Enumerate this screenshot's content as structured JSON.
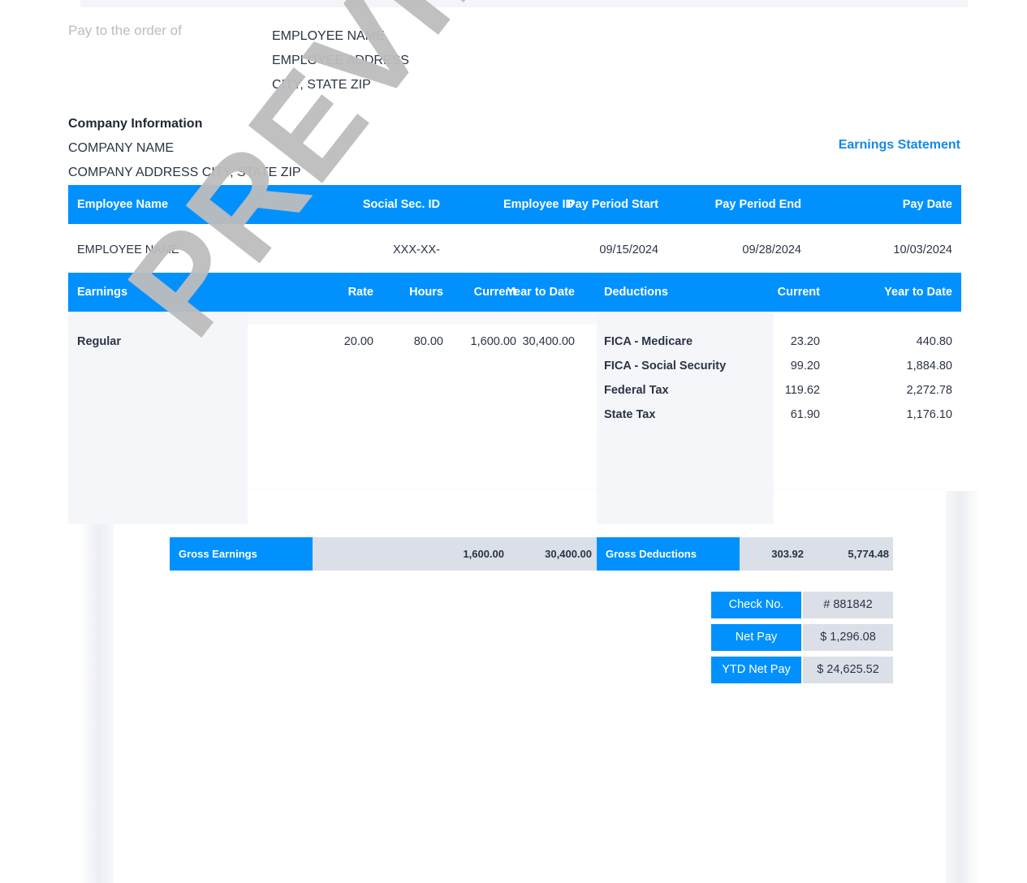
{
  "document": {
    "type": "paystub",
    "watermark": "PREVIEW ONLY",
    "statement_title": "Earnings Statement"
  },
  "theme": {
    "accent_blue": "#0091ff",
    "title_blue": "#1489e8",
    "tint_gray": "#f4f6fa",
    "strip_gray": "#dbdfe8",
    "text_dark": "#2b3445",
    "muted_gray": "#b9bcc4",
    "watermark_gray": "#bdbdbd"
  },
  "check": {
    "pay_to_label": "Pay to the order of",
    "payee_lines": [
      "EMPLOYEE NAME",
      "EMPLOYEE ADDRESS",
      "CITY, STATE ZIP"
    ]
  },
  "company": {
    "heading": "Company Information",
    "name": "COMPANY NAME",
    "address": "COMPANY ADDRESS CITY, STATE ZIP"
  },
  "employee_table": {
    "columns": [
      "Employee Name",
      "Social Sec. ID",
      "Employee ID",
      "Pay Period Start",
      "Pay Period End",
      "Pay Date"
    ],
    "row": {
      "employee_name": "EMPLOYEE NAME",
      "social_sec_id": "XXX-XX-",
      "employee_id": "",
      "pay_period_start": "09/15/2024",
      "pay_period_end": "09/28/2024",
      "pay_date": "10/03/2024"
    }
  },
  "earnings_table": {
    "columns": {
      "earnings": "Earnings",
      "rate": "Rate",
      "hours": "Hours",
      "current": "Current",
      "ytd": "Year to Date"
    },
    "rows": [
      {
        "label": "Regular",
        "rate": "20.00",
        "hours": "80.00",
        "current": "1,600.00",
        "ytd": "30,400.00"
      }
    ]
  },
  "deductions_table": {
    "columns": {
      "deductions": "Deductions",
      "current": "Current",
      "ytd": "Year to Date"
    },
    "rows": [
      {
        "label": "FICA - Medicare",
        "current": "23.20",
        "ytd": "440.80"
      },
      {
        "label": "FICA - Social Security",
        "current": "99.20",
        "ytd": "1,884.80"
      },
      {
        "label": "Federal Tax",
        "current": "119.62",
        "ytd": "2,272.78"
      },
      {
        "label": "State Tax",
        "current": "61.90",
        "ytd": "1,176.10"
      }
    ]
  },
  "totals": {
    "gross_earnings_label": "Gross Earnings",
    "gross_earnings_current": "1,600.00",
    "gross_earnings_ytd": "30,400.00",
    "gross_deductions_label": "Gross Deductions",
    "gross_deductions_current": "303.92",
    "gross_deductions_ytd": "5,774.48"
  },
  "summary": {
    "rows": [
      {
        "label": "Check No.",
        "value": "# 881842"
      },
      {
        "label": "Net Pay",
        "value": "$ 1,296.08"
      },
      {
        "label": "YTD Net Pay",
        "value": "$ 24,625.52"
      }
    ]
  }
}
